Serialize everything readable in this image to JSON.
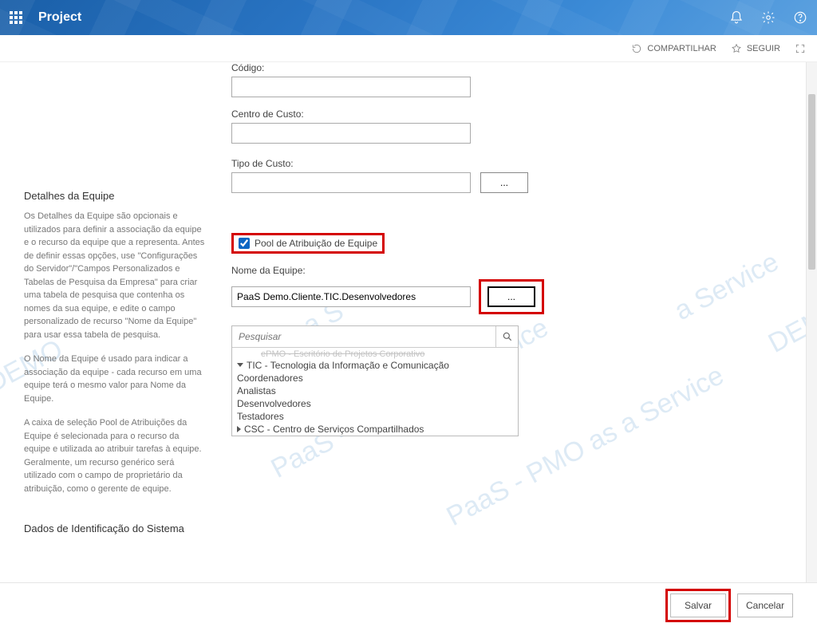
{
  "watermark_full": "PaaS - PMO as a Service",
  "watermark_demo": "DEMO",
  "header": {
    "app_title": "Project"
  },
  "actions": {
    "share": "COMPARTILHAR",
    "follow": "SEGUIR"
  },
  "upper_form": {
    "codigo_label": "Código:",
    "codigo_value": "",
    "centro_custo_label": "Centro de Custo:",
    "centro_custo_value": "",
    "tipo_custo_label": "Tipo de Custo:",
    "tipo_custo_value": "",
    "browse_label": "..."
  },
  "team": {
    "section_title": "Detalhes da Equipe",
    "desc1": "Os Detalhes da Equipe são opcionais e utilizados para definir a associação da equipe e o recurso da equipe que a representa. Antes de definir essas opções, use \"Configurações do Servidor\"/\"Campos Personalizados e Tabelas de Pesquisa da Empresa\" para criar uma tabela de pesquisa que contenha os nomes da sua equipe, e edite o campo personalizado de recurso \"Nome da Equipe\" para usar essa tabela de pesquisa.",
    "desc2": "O Nome da Equipe é usado para indicar a associação da equipe - cada recurso em uma equipe terá o mesmo valor para Nome da Equipe.",
    "desc3": "A caixa de seleção Pool de Atribuições da Equipe é selecionada para o recurso da equipe e utilizada ao atribuir tarefas à equipe. Geralmente, um recurso genérico será utilizado com o campo de proprietário da atribuição, como o gerente de equipe.",
    "pool_label": "Pool de Atribuição de Equipe",
    "pool_checked": true,
    "name_label": "Nome da Equipe:",
    "name_value": "PaaS Demo.Cliente.TIC.Desenvolvedores",
    "browse_label": "..."
  },
  "lookup": {
    "search_placeholder": "Pesquisar",
    "truncated_top": "ePMO - Escritório de Projetos Corporativo",
    "items": [
      {
        "level": 1,
        "expandable": true,
        "open": true,
        "label": "TIC - Tecnologia da Informação e Comunicação"
      },
      {
        "level": 2,
        "expandable": false,
        "label": "Coordenadores"
      },
      {
        "level": 2,
        "expandable": false,
        "label": "Analistas"
      },
      {
        "level": 2,
        "expandable": false,
        "label": "Desenvolvedores"
      },
      {
        "level": 2,
        "expandable": false,
        "label": "Testadores"
      },
      {
        "level": 1,
        "expandable": true,
        "open": false,
        "label": "CSC - Centro de Serviços Compartilhados"
      }
    ]
  },
  "sysdata": {
    "section_title": "Dados de Identificação do Sistema"
  },
  "footer": {
    "save": "Salvar",
    "cancel": "Cancelar"
  }
}
